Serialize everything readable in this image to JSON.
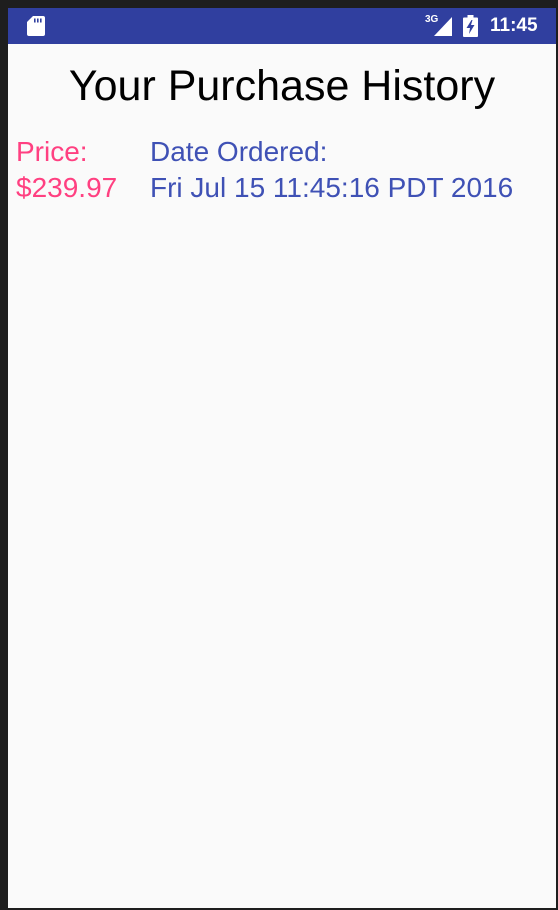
{
  "status_bar": {
    "network_type": "3G",
    "time": "11:45",
    "icons": [
      "sd-card-icon",
      "cell-signal-icon",
      "battery-charging-icon"
    ],
    "background_color": "#303f9f"
  },
  "page": {
    "title": "Your Purchase History"
  },
  "purchase": {
    "price_label": "Price:",
    "price_value": "$239.97",
    "date_label": "Date Ordered:",
    "date_value": "Fri Jul 15 11:45:16 PDT 2016"
  },
  "colors": {
    "price_text": "#ff4081",
    "date_text": "#3f51b5",
    "background": "#fafafa"
  }
}
